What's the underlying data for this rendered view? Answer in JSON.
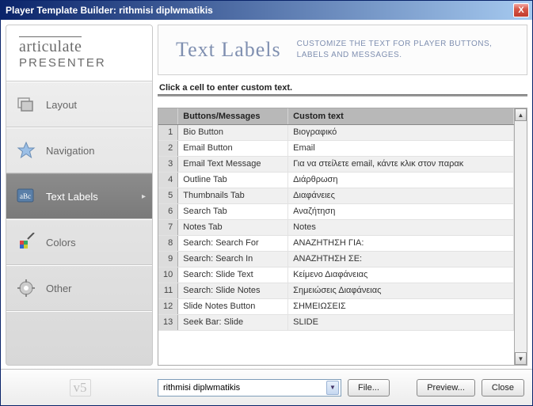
{
  "window": {
    "title": "Player Template Builder: rithmisi diplwmatikis",
    "close": "X"
  },
  "logo": {
    "top": "articulate",
    "bottom": "PRESENTER"
  },
  "sidebar": {
    "items": [
      {
        "label": "Layout"
      },
      {
        "label": "Navigation"
      },
      {
        "label": "Text Labels"
      },
      {
        "label": "Colors"
      },
      {
        "label": "Other"
      }
    ]
  },
  "header": {
    "title": "Text Labels",
    "desc": "CUSTOMIZE THE TEXT FOR PLAYER BUTTONS, LABELS  AND MESSAGES."
  },
  "instruction": "Click a cell to enter custom text.",
  "grid": {
    "col1": "Buttons/Messages",
    "col2": "Custom text",
    "rows": [
      {
        "n": "1",
        "a": "Bio Button",
        "b": "Βιογραφικό"
      },
      {
        "n": "2",
        "a": "Email Button",
        "b": "Email"
      },
      {
        "n": "3",
        "a": "Email Text Message",
        "b": "Για να στείλετε email, κάντε κλικ στον παρακ"
      },
      {
        "n": "4",
        "a": "Outline Tab",
        "b": "Διάρθρωση"
      },
      {
        "n": "5",
        "a": "Thumbnails Tab",
        "b": "Διαφάνειες"
      },
      {
        "n": "6",
        "a": "Search Tab",
        "b": "Αναζήτηση"
      },
      {
        "n": "7",
        "a": "Notes Tab",
        "b": "Notes"
      },
      {
        "n": "8",
        "a": "Search: Search For",
        "b": "ΑΝΑΖΗΤΗΣΗ ΓΙΑ:"
      },
      {
        "n": "9",
        "a": "Search: Search In",
        "b": "ΑΝΑΖΗΤΗΣΗ ΣΕ:"
      },
      {
        "n": "10",
        "a": "Search: Slide Text",
        "b": "Κείμενο Διαφάνειας"
      },
      {
        "n": "11",
        "a": "Search: Slide Notes",
        "b": "Σημειώσεις Διαφάνειας"
      },
      {
        "n": "12",
        "a": "Slide Notes Button",
        "b": "ΣΗΜΕΙΩΣΕΙΣ"
      },
      {
        "n": "13",
        "a": "Seek Bar: Slide",
        "b": "SLIDE"
      }
    ]
  },
  "footer": {
    "version": "v5",
    "template_name": "rithmisi diplwmatikis",
    "file": "File...",
    "preview": "Preview...",
    "close": "Close"
  }
}
